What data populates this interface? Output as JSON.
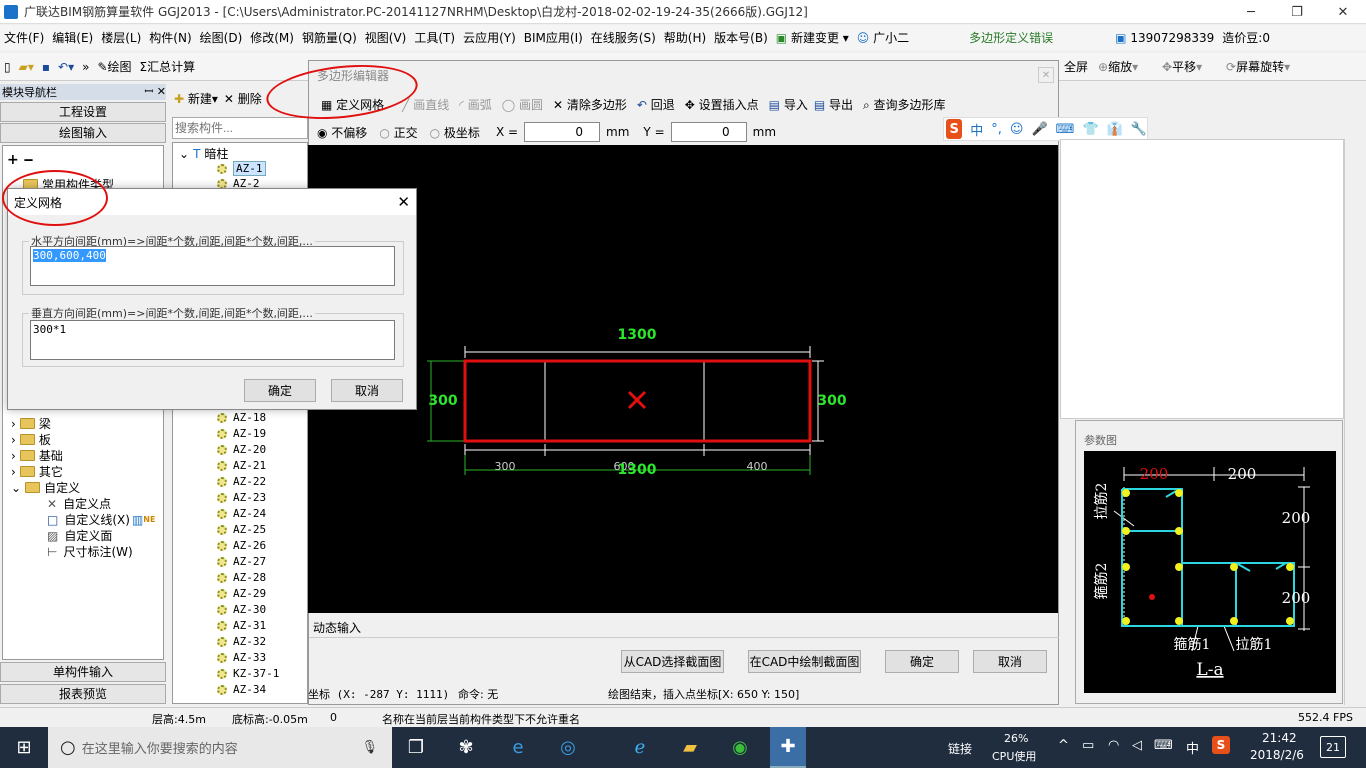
{
  "window": {
    "title": "广联达BIM钢筋算量软件 GGJ2013 - [C:\\Users\\Administrator.PC-20141127NRHM\\Desktop\\白龙村-2018-02-02-19-24-35(2666版).GGJ12]",
    "minimize": "─",
    "restore": "❐",
    "close": "✕"
  },
  "menu": {
    "items": [
      "文件(F)",
      "编辑(E)",
      "楼层(L)",
      "构件(N)",
      "绘图(D)",
      "修改(M)",
      "钢筋量(Q)",
      "视图(V)",
      "工具(T)",
      "云应用(Y)",
      "BIM应用(I)",
      "在线服务(S)",
      "帮助(H)",
      "版本号(B)",
      "新建变更",
      "广小二"
    ],
    "error_text": "多边形定义错误",
    "phone": "13907298339",
    "coins": "造价豆:0"
  },
  "toolbar": {
    "draw": "绘图",
    "sum": "汇总计算",
    "fullscreen": "全屏",
    "zoom": "缩放",
    "pan": "平移",
    "rotate": "屏幕旋转"
  },
  "nav": {
    "header": "模块导航栏",
    "pin": "ꟷ",
    "close": "✕",
    "project_settings": "工程设置",
    "drawing_input": "绘图输入",
    "common_types": "常用构件类型",
    "tree": [
      "梁",
      "板",
      "基础",
      "其它",
      "自定义"
    ],
    "custom_children": [
      "自定义点",
      "自定义线(X)",
      "自定义面",
      "尺寸标注(W)"
    ],
    "new_badge": "NE",
    "single_input": "单构件输入",
    "report": "报表预览"
  },
  "components": {
    "new": "新建",
    "delete": "删除",
    "search_placeholder": "搜索构件...",
    "root": "暗柱",
    "items": [
      "AZ-1",
      "AZ-2",
      "AZ-18",
      "AZ-19",
      "AZ-20",
      "AZ-21",
      "AZ-22",
      "AZ-23",
      "AZ-24",
      "AZ-25",
      "AZ-26",
      "AZ-27",
      "AZ-28",
      "AZ-29",
      "AZ-30",
      "AZ-31",
      "AZ-32",
      "AZ-33",
      "KZ-37-1",
      "AZ-34"
    ]
  },
  "editor": {
    "title": "多边形编辑器",
    "tools": [
      "定义网格",
      "画直线",
      "画弧",
      "画圆",
      "清除多边形",
      "回退",
      "设置插入点",
      "导入",
      "导出",
      "查询多边形库"
    ],
    "offset_options": [
      "不偏移",
      "正交",
      "极坐标"
    ],
    "x_label": "X =",
    "x_value": "0",
    "y_label": "Y =",
    "y_value": "0",
    "unit": "mm",
    "dynamic_input": "动态输入",
    "btn_cad_select": "从CAD选择截面图",
    "btn_cad_draw": "在CAD中绘制截面图",
    "ok": "确定",
    "cancel": "取消",
    "coord": "坐标 (X: -287 Y: 1111)",
    "command": "命令: 无",
    "status": "绘图结束，插入点坐标[X: 650 Y: 150]"
  },
  "drawing": {
    "total": "1300",
    "height_left": "300",
    "height_right": "300",
    "seg1": "300",
    "seg2": "600",
    "seg3": "400",
    "total_overlap": "1300"
  },
  "ime": {
    "items": [
      "中",
      "°,",
      "☺",
      "🎤",
      "⌨",
      "👕",
      "👔",
      "🔧"
    ]
  },
  "dialog": {
    "title": "定义网格",
    "h_label": "水平方向间距(mm)=>间距*个数,间距,间距*个数,间距,...",
    "h_value": "300,600,400",
    "v_label": "垂直方向间距(mm)=>间距*个数,间距,间距*个数,间距,...",
    "v_value": "300*1",
    "ok": "确定",
    "cancel": "取消"
  },
  "param": {
    "title": "参数图",
    "labels": {
      "top1": "200",
      "top2": "200",
      "right1": "200",
      "right2": "200",
      "tie2": "拉筋2",
      "stirrup2": "箍筋2",
      "stirrup1": "箍筋1",
      "tie1": "拉筋1",
      "name": "L-a"
    }
  },
  "statusbar": {
    "floor_height": "层高:4.5m",
    "base_height": "底标高:-0.05m",
    "zero": "0",
    "message": "名称在当前层当前构件类型下不允许重名",
    "fps": "552.4 FPS"
  },
  "taskbar": {
    "search_placeholder": "在这里输入你要搜索的内容",
    "link": "链接",
    "cpu_pct": "26%",
    "cpu_label": "CPU使用",
    "ime": "中",
    "time": "21:42",
    "date": "2018/2/6",
    "notify": "21"
  }
}
